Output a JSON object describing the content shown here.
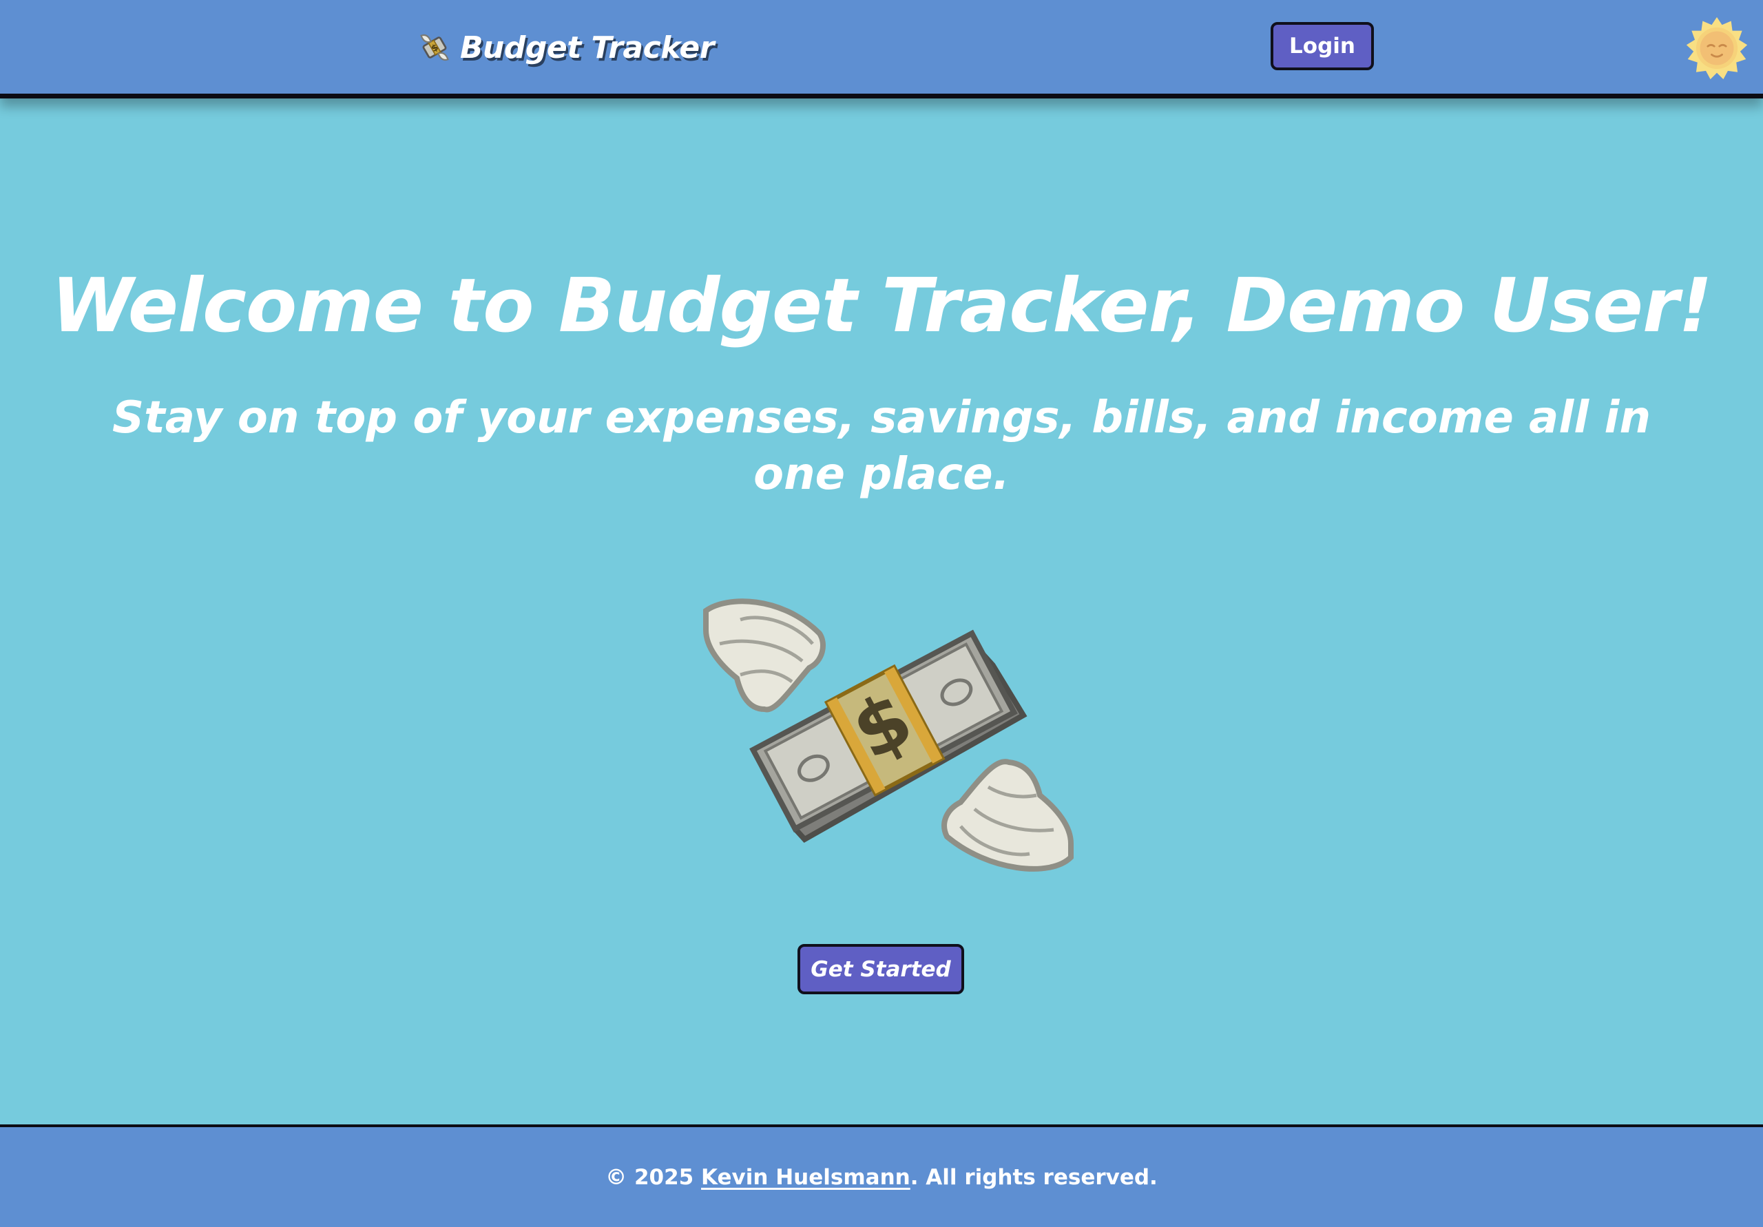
{
  "header": {
    "brand_icon": "money-with-wings-icon",
    "brand_title": "Budget Tracker",
    "login_label": "Login",
    "theme_toggle_icon": "sun-moon-icon"
  },
  "main": {
    "welcome_title": "Welcome to Budget Tracker, Demo User!",
    "tagline": "Stay on top of your expenses, savings, bills, and income all in one place.",
    "hero_icon": "money-with-wings-icon",
    "cta_label": "Get Started"
  },
  "footer": {
    "copyright_prefix": "© 2025 ",
    "author_link": "Kevin Huelsmann",
    "copyright_suffix": ". All rights reserved."
  },
  "colors": {
    "page_background": "#76cbdd",
    "header_background": "#5e8fd2",
    "footer_background": "#5e8fd2",
    "button_background": "#5f5fc4",
    "button_border": "#10101c",
    "text": "#ffffff"
  }
}
